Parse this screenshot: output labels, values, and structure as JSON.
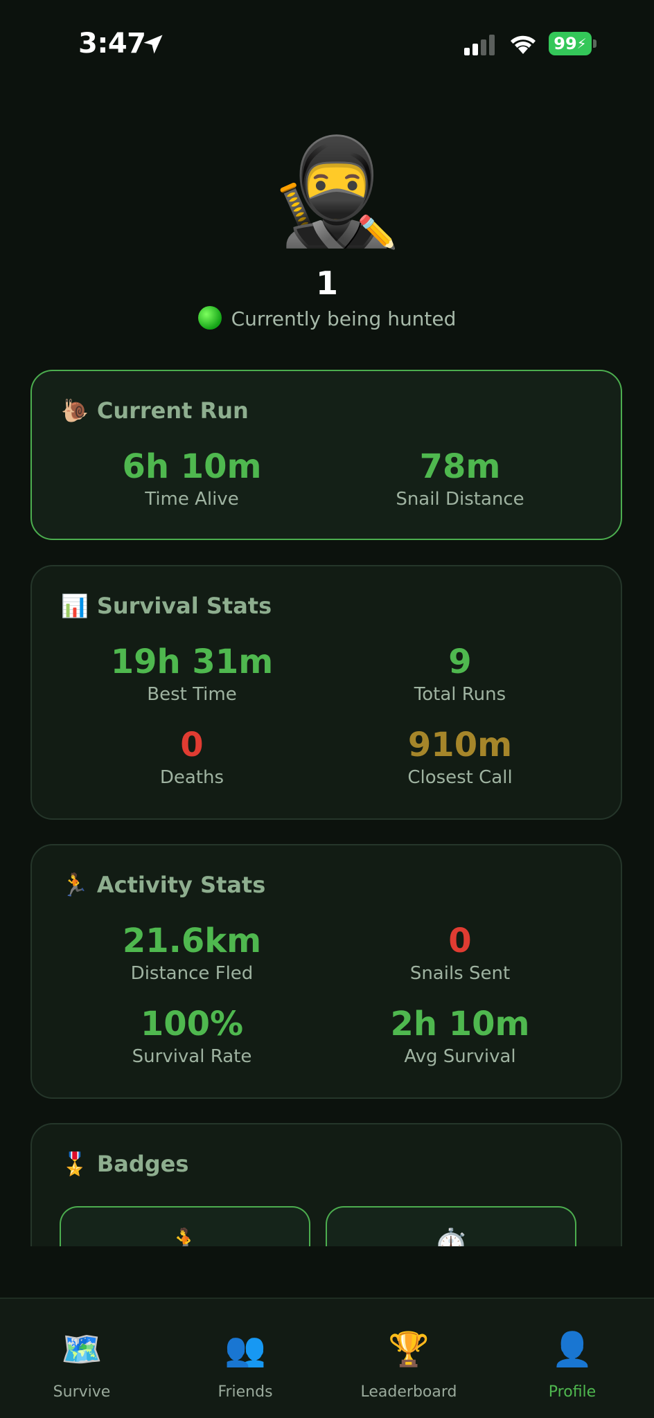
{
  "status_bar": {
    "time": "3:47",
    "battery": "99"
  },
  "profile": {
    "avatar": "🥷",
    "edit_icon": "✏️",
    "name": "1",
    "status_text": "Currently being hunted"
  },
  "current_run": {
    "title": "Current Run",
    "icon": "🐌",
    "stats": [
      {
        "value": "6h 10m",
        "label": "Time Alive"
      },
      {
        "value": "78m",
        "label": "Snail Distance"
      }
    ]
  },
  "survival_stats": {
    "title": "Survival Stats",
    "icon": "📊",
    "stats": [
      {
        "value": "19h 31m",
        "label": "Best Time"
      },
      {
        "value": "9",
        "label": "Total Runs"
      },
      {
        "value": "0",
        "label": "Deaths"
      },
      {
        "value": "910m",
        "label": "Closest Call"
      }
    ]
  },
  "activity_stats": {
    "title": "Activity Stats",
    "icon": "🏃",
    "stats": [
      {
        "value": "21.6km",
        "label": "Distance Fled"
      },
      {
        "value": "0",
        "label": "Snails Sent"
      },
      {
        "value": "100%",
        "label": "Survival Rate"
      },
      {
        "value": "2h 10m",
        "label": "Avg Survival"
      }
    ]
  },
  "badges": {
    "title": "Badges",
    "icon": "🎖️",
    "items": [
      {
        "icon": "🏃"
      },
      {
        "icon": "⏱️"
      }
    ]
  },
  "tabbar": {
    "tabs": [
      {
        "label": "Survive",
        "icon": "🗺️"
      },
      {
        "label": "Friends",
        "icon": "👥"
      },
      {
        "label": "Leaderboard",
        "icon": "🏆"
      },
      {
        "label": "Profile",
        "icon": "👤"
      }
    ],
    "active": "Profile"
  },
  "colors": {
    "accent": "#4fb84f",
    "danger": "#e03c32",
    "warning": "#a6862a",
    "background": "#0c120d"
  }
}
